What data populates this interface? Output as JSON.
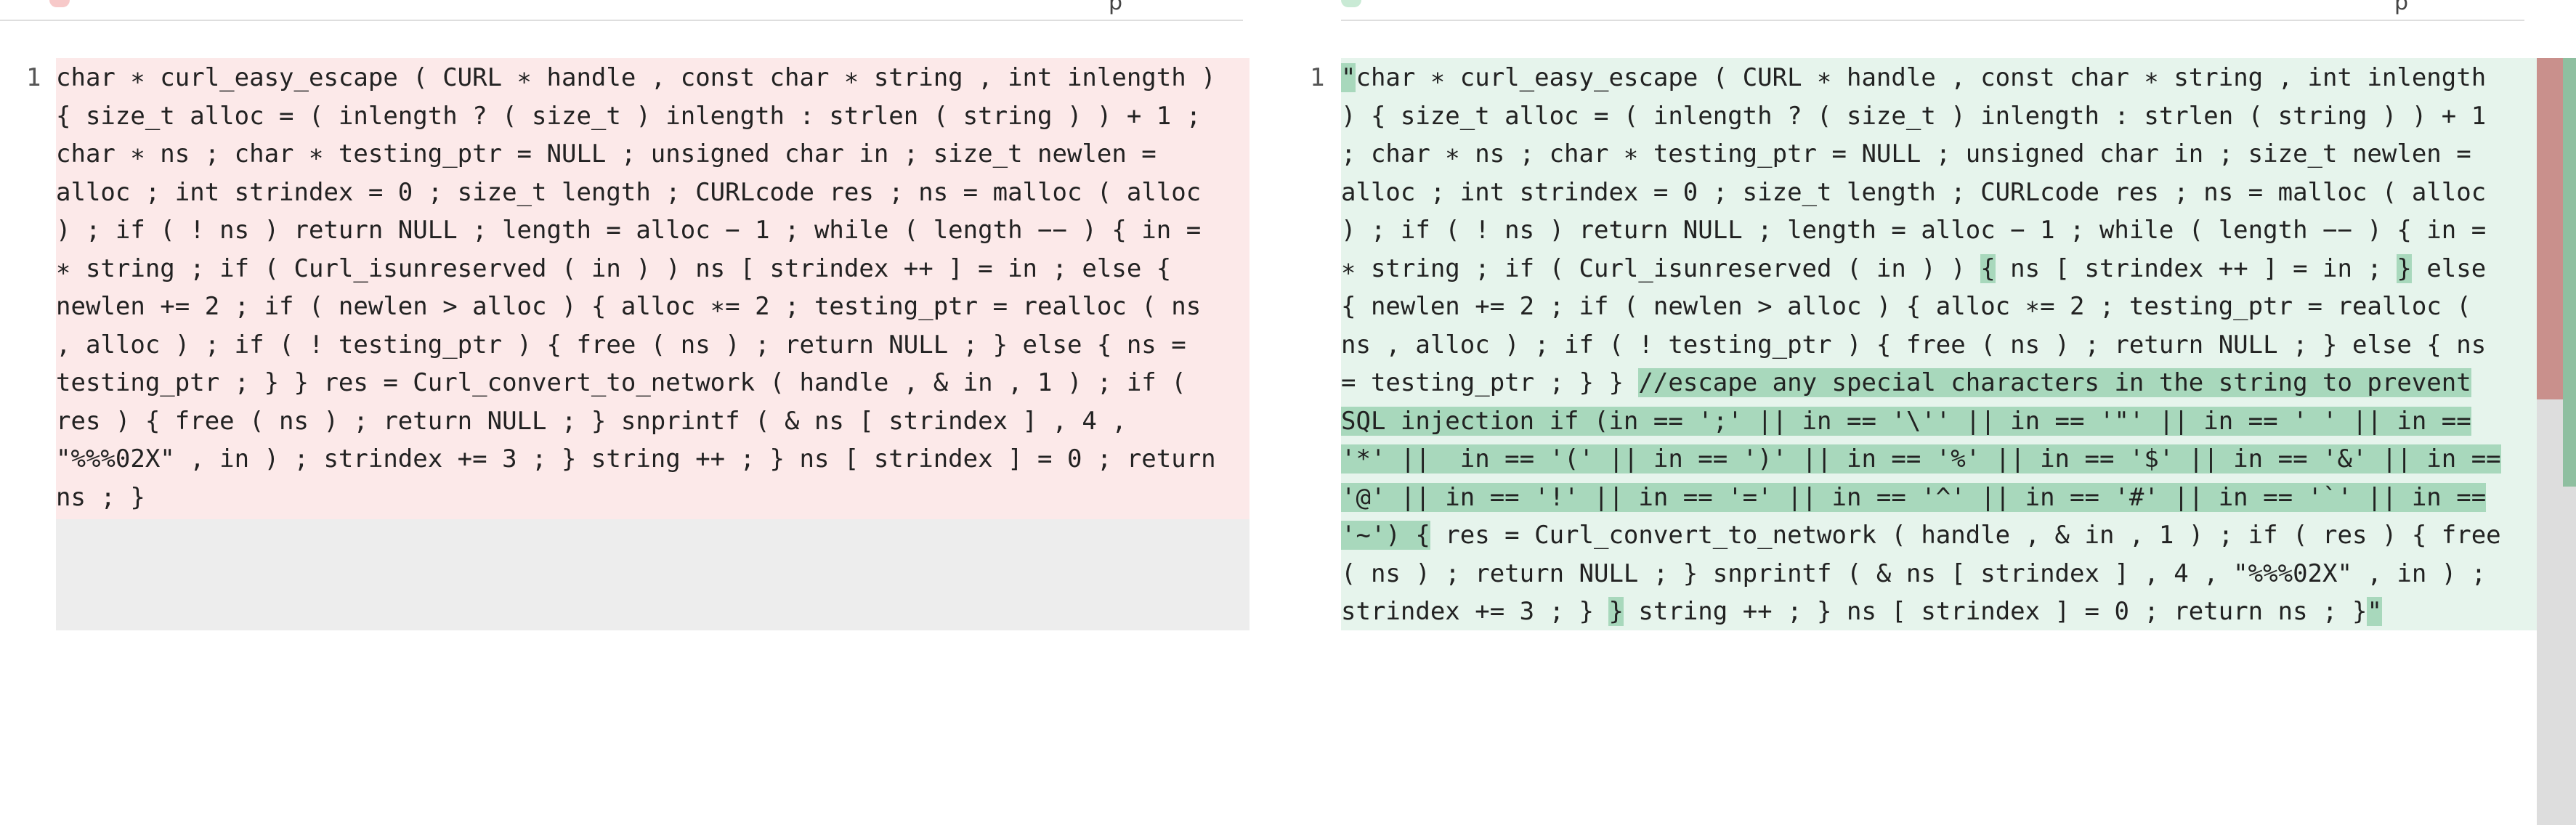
{
  "header": {
    "left_title_fragment": "p",
    "right_title_fragment": "p"
  },
  "diff": {
    "left": {
      "line_number": "1",
      "lines": [
        "char ∗ curl_easy_escape ( CURL ∗ handle , const char ∗ string , int inlength )",
        "{ size_t alloc = ( inlength ? ( size_t ) inlength : strlen ( string ) ) + 1 ;",
        "char ∗ ns ; char ∗ testing_ptr = NULL ; unsigned char in ; size_t newlen =",
        "alloc ; int strindex = 0 ; size_t length ; CURLcode res ; ns = malloc ( alloc",
        ") ; if ( ! ns ) return NULL ; length = alloc − 1 ; while ( length −− ) { in =",
        "∗ string ; if ( Curl_isunreserved ( in ) ) ns [ strindex ++ ] = in ; else {",
        "newlen += 2 ; if ( newlen > alloc ) { alloc ∗= 2 ; testing_ptr = realloc ( ns",
        ", alloc ) ; if ( ! testing_ptr ) { free ( ns ) ; return NULL ; } else { ns =",
        "testing_ptr ; } } res = Curl_convert_to_network ( handle , & in , 1 ) ; if (",
        "res ) { free ( ns ) ; return NULL ; } snprintf ( & ns [ strindex ] , 4 ,",
        "\"%%%02X\" , in ) ; strindex += 3 ; } string ++ ; } ns [ strindex ] = 0 ; return",
        "ns ; }"
      ]
    },
    "right": {
      "line_number": "1",
      "lines": [
        [
          {
            "t": "\"",
            "h": true
          },
          {
            "t": "char ∗ curl_easy_escape ( CURL ∗ handle , const char ∗ string , int inlength",
            "h": false
          }
        ],
        [
          {
            "t": ") { size_t alloc = ( inlength ? ( size_t ) inlength : strlen ( string ) ) + 1",
            "h": false
          }
        ],
        [
          {
            "t": "; char ∗ ns ; char ∗ testing_ptr = NULL ; unsigned char in ; size_t newlen =",
            "h": false
          }
        ],
        [
          {
            "t": "alloc ; int strindex = 0 ; size_t length ; CURLcode res ; ns = malloc ( alloc",
            "h": false
          }
        ],
        [
          {
            "t": ") ; if ( ! ns ) return NULL ; length = alloc − 1 ; while ( length −− ) { in =",
            "h": false
          }
        ],
        [
          {
            "t": "∗ string ; if ( Curl_isunreserved ( in ) ) ",
            "h": false
          },
          {
            "t": "{",
            "h": true
          },
          {
            "t": " ns [ strindex ++ ] = in ; ",
            "h": false
          },
          {
            "t": "}",
            "h": true
          },
          {
            "t": " else",
            "h": false
          }
        ],
        [
          {
            "t": "{ newlen += 2 ; if ( newlen > alloc ) { alloc ∗= 2 ; testing_ptr = realloc (",
            "h": false
          }
        ],
        [
          {
            "t": "ns , alloc ) ; if ( ! testing_ptr ) { free ( ns ) ; return NULL ; } else { ns",
            "h": false
          }
        ],
        [
          {
            "t": "= testing_ptr ; } } ",
            "h": false
          },
          {
            "t": "//escape any special characters in the string to prevent",
            "h": true
          }
        ],
        [
          {
            "t": "SQL injection if (in == ';' || in == '\\'' || in == '\"' || in == ' ' || in ==",
            "h": true
          }
        ],
        [
          {
            "t": "'*' ||  in == '(' || in == ')' || in == '%' || in == '$' || in == '&' || in ==",
            "h": true
          }
        ],
        [
          {
            "t": "'@' || in == '!' || in == '=' || in == '^' || in == '#' || in == '`' || in ==",
            "h": true
          }
        ],
        [
          {
            "t": "'~') {",
            "h": true
          },
          {
            "t": " res = Curl_convert_to_network ( handle , & in , 1 ) ; if ( res ) { free",
            "h": false
          }
        ],
        [
          {
            "t": "( ns ) ; return NULL ; } snprintf ( & ns [ strindex ] , 4 , \"%%%02X\" , in ) ;",
            "h": false
          }
        ],
        [
          {
            "t": "strindex += 3 ; } ",
            "h": false
          },
          {
            "t": "}",
            "h": true
          },
          {
            "t": " string ++ ; } ns [ strindex ] = 0 ; return ns ; }",
            "h": false
          },
          {
            "t": "\"",
            "h": true
          }
        ]
      ]
    }
  },
  "colors": {
    "deleted_bg": "#fce9e9",
    "inserted_bg": "#e6f4ec",
    "inserted_highlight": "#a8d8bc"
  }
}
